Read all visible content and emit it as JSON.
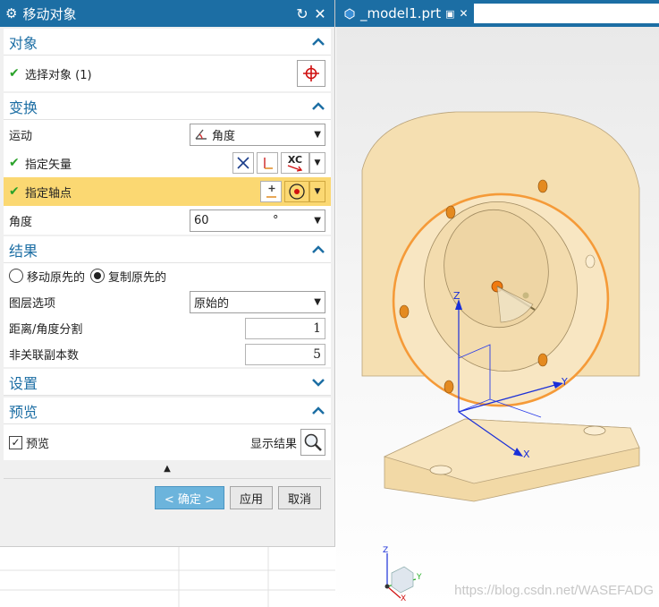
{
  "dialog": {
    "title": "移动对象",
    "reset_icon": "reset-icon",
    "close_icon": "close-icon"
  },
  "object": {
    "header": "对象",
    "select_label": "选择对象 (1)"
  },
  "transform": {
    "header": "变换",
    "motion_label": "运动",
    "motion_value": "角度",
    "vector_label": "指定矢量",
    "vector_type": "XC",
    "pivot_label": "指定轴点",
    "angle_label": "角度",
    "angle_value": "60",
    "angle_unit": "°"
  },
  "result": {
    "header": "结果",
    "move_original": "移动原先的",
    "copy_original": "复制原先的",
    "layer_label": "图层选项",
    "layer_value": "原始的",
    "distance_label": "距离/角度分割",
    "distance_value": "1",
    "copies_label": "非关联副本数",
    "copies_value": "5"
  },
  "settings": {
    "header": "设置"
  },
  "preview": {
    "header": "预览",
    "preview_label": "预览",
    "show_result_label": "显示结果"
  },
  "buttons": {
    "ok": "< 确定 >",
    "apply": "应用",
    "cancel": "取消"
  },
  "tab": {
    "name": "_model1.prt"
  },
  "viewport": {
    "axis_z": "Z",
    "axis_y": "Y",
    "axis_x": "X",
    "watermark": "https://blog.csdn.net/WASEFADG"
  },
  "colors": {
    "accent": "#1c6ea4",
    "highlight": "#fbd872",
    "part": "#f5dfb1",
    "selection": "#f59a38"
  }
}
